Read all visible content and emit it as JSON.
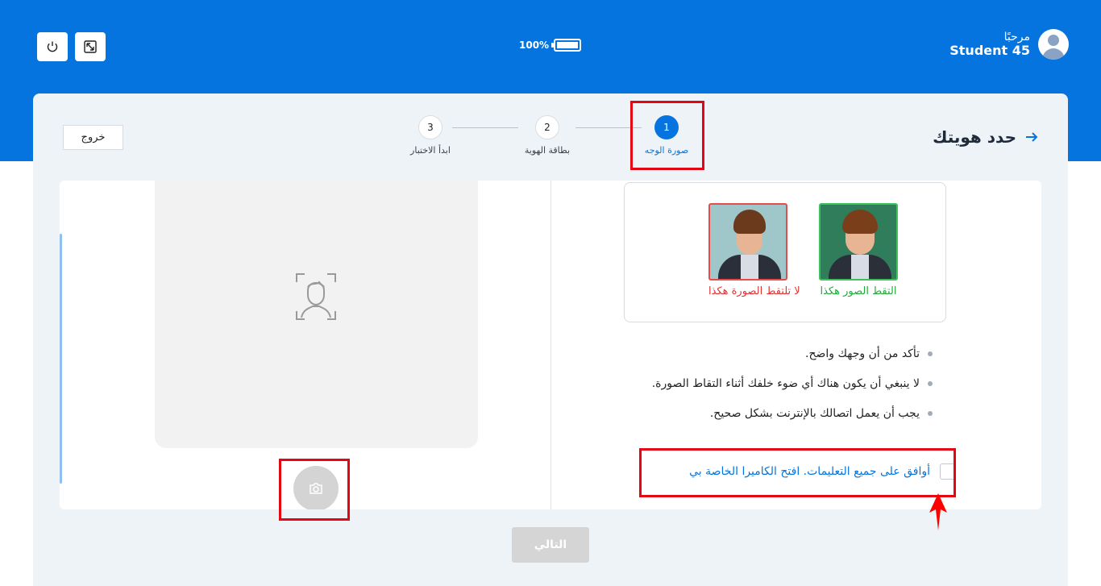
{
  "header": {
    "greeting": "مرحبًا",
    "username": "Student 45",
    "battery_level": "100%",
    "power_icon": "power-icon",
    "fullscreen_icon": "exit-fullscreen-icon",
    "brand_color": "#0674df"
  },
  "page": {
    "title": "حدد هويتك",
    "back_icon": "arrow-right-icon",
    "exit_label": "خروج"
  },
  "steps": [
    {
      "number": "1",
      "label": "صورة الوجه",
      "active": true
    },
    {
      "number": "2",
      "label": "بطاقة الهوية",
      "active": false
    },
    {
      "number": "3",
      "label": "ابدأ الاختبار",
      "active": false
    }
  ],
  "examples": {
    "good_label": "التقط الصور هكذا",
    "bad_label": "لا تلتقط الصورة هكذا",
    "good_color": "#22a83a",
    "bad_color": "#e03030"
  },
  "instructions": [
    "تأكد من أن وجهك واضح.",
    "لا ينبغي أن يكون هناك أي ضوء خلفك أثناء التقاط الصورة.",
    "يجب أن يعمل اتصالك بالإنترنت بشكل صحيح."
  ],
  "agreement": {
    "label": "أوافق على جميع التعليمات. افتح الكاميرا الخاصة بي",
    "checked": false
  },
  "camera": {
    "placeholder_icon": "face-scan-icon",
    "capture_icon": "camera-icon"
  },
  "footer": {
    "next_label": "التالي"
  }
}
